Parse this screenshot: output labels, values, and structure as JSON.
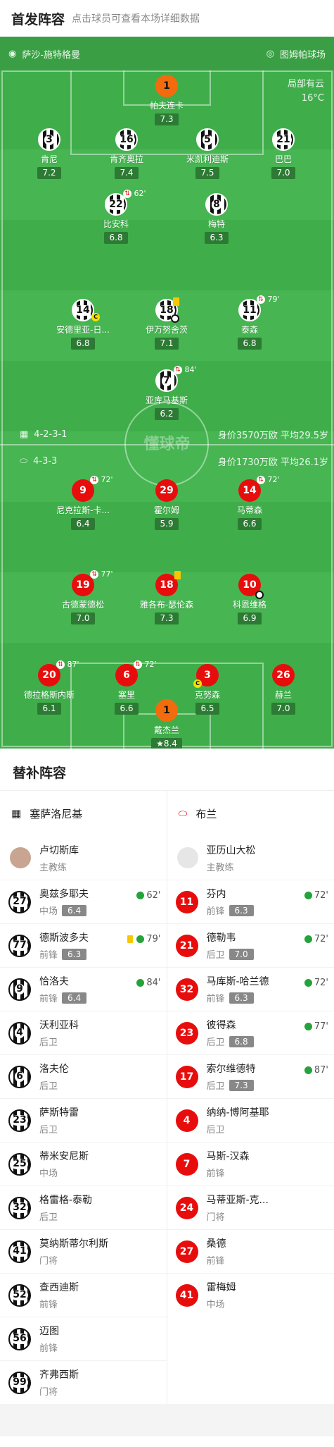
{
  "header": {
    "title": "首发阵容",
    "subtitle": "点击球员可查看本场详细数据"
  },
  "pitch": {
    "home_team_label": "萨沙-施特格曼",
    "venue": "图姆帕球场",
    "weather_line1": "局部有云",
    "weather_line2": "16°C",
    "watermark": "懂球帝",
    "home_formation": "4-2-3-1",
    "home_info": "身价3570万欧 平均29.5岁",
    "away_formation": "4-3-3",
    "away_info": "身价1730万欧 平均26.1岁"
  },
  "home_players": [
    {
      "num": "1",
      "name": "帕夫连卡",
      "rating": "7.3"
    },
    {
      "num": "3",
      "name": "肯尼",
      "rating": "7.2"
    },
    {
      "num": "16",
      "name": "肯齐奥拉",
      "rating": "7.4"
    },
    {
      "num": "5",
      "name": "米凯利迪斯",
      "rating": "7.5"
    },
    {
      "num": "21",
      "name": "巴巴",
      "rating": "7.0"
    },
    {
      "num": "22",
      "name": "比安科",
      "rating": "6.8",
      "sub": "62'"
    },
    {
      "num": "8",
      "name": "梅特",
      "rating": "6.3"
    },
    {
      "num": "14",
      "name": "安德里亚-日...",
      "rating": "6.8"
    },
    {
      "num": "18",
      "name": "伊万努舍茨",
      "rating": "7.1"
    },
    {
      "num": "11",
      "name": "泰森",
      "rating": "6.8",
      "sub": "79'"
    },
    {
      "num": "7",
      "name": "亚库马基斯",
      "rating": "6.2",
      "sub": "84'"
    }
  ],
  "away_players": [
    {
      "num": "9",
      "name": "尼克拉斯-卡...",
      "rating": "6.4",
      "sub": "72'"
    },
    {
      "num": "29",
      "name": "霍尔姆",
      "rating": "5.9"
    },
    {
      "num": "14",
      "name": "马蒂森",
      "rating": "6.6",
      "sub": "72'"
    },
    {
      "num": "19",
      "name": "古德蒙德松",
      "rating": "7.0",
      "sub": "77'"
    },
    {
      "num": "18",
      "name": "雅各布-瑟伦森",
      "rating": "7.3"
    },
    {
      "num": "10",
      "name": "科恩维格",
      "rating": "6.9"
    },
    {
      "num": "20",
      "name": "德拉格斯内斯",
      "rating": "6.1",
      "sub": "87'"
    },
    {
      "num": "6",
      "name": "塞里",
      "rating": "6.6",
      "sub": "72'"
    },
    {
      "num": "3",
      "name": "克努森",
      "rating": "6.5"
    },
    {
      "num": "26",
      "name": "赫兰",
      "rating": "7.0"
    },
    {
      "num": "1",
      "name": "戴杰兰",
      "rating": "8.4"
    }
  ],
  "subs": {
    "title": "替补阵容",
    "home_team": "塞萨洛尼基",
    "away_team": "布兰",
    "home_coach": {
      "name": "卢切斯库",
      "role": "主教练"
    },
    "away_coach": {
      "name": "亚历山大松",
      "role": "主教练"
    },
    "home": [
      {
        "num": "27",
        "name": "奥兹多耶夫",
        "pos": "中场",
        "rating": "6.4",
        "in": "62'"
      },
      {
        "num": "77",
        "name": "德斯波多夫",
        "pos": "前锋",
        "rating": "6.3",
        "in": "79'"
      },
      {
        "num": "9",
        "name": "恰洛夫",
        "pos": "前锋",
        "rating": "6.4",
        "in": "84'"
      },
      {
        "num": "4",
        "name": "沃利亚科",
        "pos": "后卫"
      },
      {
        "num": "6",
        "name": "洛夫伦",
        "pos": "后卫"
      },
      {
        "num": "23",
        "name": "萨斯特雷",
        "pos": "后卫"
      },
      {
        "num": "25",
        "name": "蒂米安尼斯",
        "pos": "中场"
      },
      {
        "num": "32",
        "name": "格雷格-泰勒",
        "pos": "后卫"
      },
      {
        "num": "41",
        "name": "莫纳斯蒂尔利斯",
        "pos": "门将"
      },
      {
        "num": "52",
        "name": "查西迪斯",
        "pos": "前锋"
      },
      {
        "num": "56",
        "name": "迈图",
        "pos": "前锋"
      },
      {
        "num": "99",
        "name": "齐弗西斯",
        "pos": "门将"
      }
    ],
    "away": [
      {
        "num": "11",
        "name": "芬内",
        "pos": "前锋",
        "rating": "6.3",
        "in": "72'"
      },
      {
        "num": "21",
        "name": "德勒韦",
        "pos": "后卫",
        "rating": "7.0",
        "in": "72'"
      },
      {
        "num": "32",
        "name": "马库斯-哈兰德",
        "pos": "前锋",
        "rating": "6.3",
        "in": "72'"
      },
      {
        "num": "23",
        "name": "彼得森",
        "pos": "后卫",
        "rating": "6.8",
        "in": "77'"
      },
      {
        "num": "17",
        "name": "索尔维德特",
        "pos": "后卫",
        "rating": "7.3",
        "in": "87'"
      },
      {
        "num": "4",
        "name": "纳纳-博阿基耶",
        "pos": "后卫"
      },
      {
        "num": "7",
        "name": "马斯-汉森",
        "pos": "前锋"
      },
      {
        "num": "24",
        "name": "马蒂亚斯-克...",
        "pos": "门将"
      },
      {
        "num": "27",
        "name": "桑德",
        "pos": "前锋"
      },
      {
        "num": "41",
        "name": "雷梅姆",
        "pos": "中场"
      }
    ]
  }
}
